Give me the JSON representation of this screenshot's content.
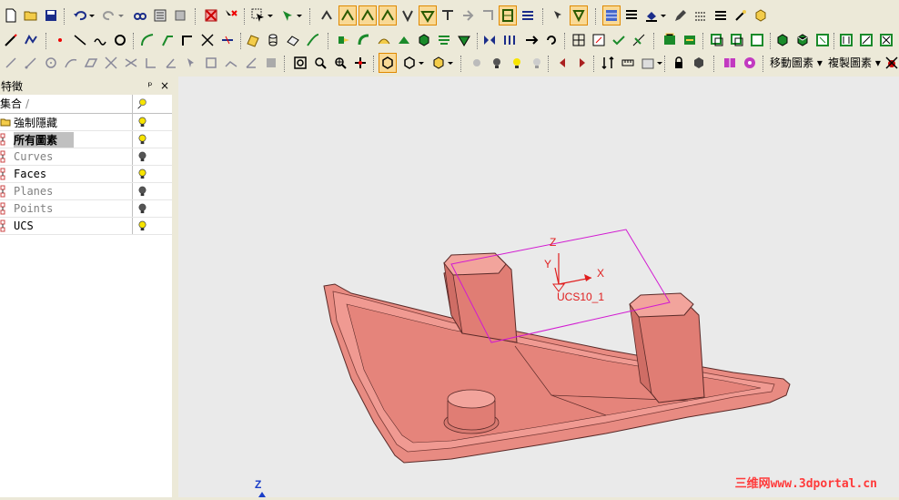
{
  "panel": {
    "title": "特徵",
    "pin_label": "ᵖ",
    "close_label": "×",
    "column_name": "集合",
    "sort_indicator": "/",
    "rows": [
      {
        "label": "強制隱藏",
        "bulb": "on",
        "style": "normal"
      },
      {
        "label": "所有圖素",
        "bulb": "on",
        "style": "selected"
      },
      {
        "label": "Curves",
        "bulb": "off",
        "style": "dim"
      },
      {
        "label": "Faces",
        "bulb": "on",
        "style": "normal"
      },
      {
        "label": "Planes",
        "bulb": "off",
        "style": "dim"
      },
      {
        "label": "Points",
        "bulb": "off",
        "style": "dim"
      },
      {
        "label": "UCS",
        "bulb": "on",
        "style": "normal"
      }
    ]
  },
  "toolbar": {
    "move_entity_label": "移動圖素",
    "copy_entity_label": "複製圖素"
  },
  "viewport": {
    "ucs_label": "UCS10_1",
    "axis_x": "X",
    "axis_y": "Y",
    "axis_z": "Z",
    "triad_z": "Z",
    "watermark": "三维网www.3dportal.cn"
  },
  "colors": {
    "part_fill": "#e8847c",
    "part_edge": "#5a2a28",
    "ucs_color": "#d11ad1",
    "axis_red": "#e01e1e",
    "triad_blue": "#1a3ec8"
  }
}
